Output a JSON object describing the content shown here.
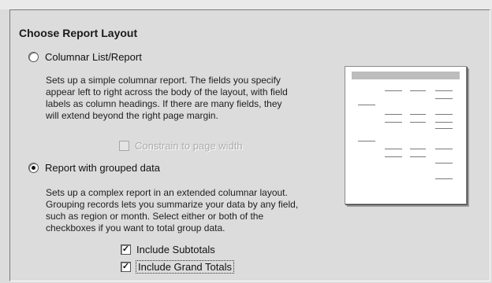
{
  "dialog": {
    "heading": "Choose Report Layout",
    "options": [
      {
        "label": "Columnar List/Report",
        "selected": false,
        "description_lines": [
          "Sets up a simple columnar report.  The fields you specify",
          "appear left to right across the body of the layout, with field",
          "labels as column headings.  If there are many fields, they",
          "will extend beyond the right page margin."
        ],
        "checkbox": {
          "label": "Constrain to page width",
          "checked": false,
          "enabled": false
        }
      },
      {
        "label": "Report with grouped data",
        "selected": true,
        "description_lines": [
          "Sets up a complex report in an extended columnar layout.",
          "Grouping records lets you summarize your data by any field,",
          "such as region or month. Select either or both of the",
          "checkboxes if you want to total group data."
        ],
        "checkboxes": [
          {
            "label": "Include Subtotals",
            "checked": true
          },
          {
            "label": "Include Grand Totals",
            "checked": true
          }
        ]
      }
    ]
  },
  "colors": {
    "dialog_bg": "#dcdcdc",
    "preview_bg": "#ffffff",
    "preview_header": "#bdbdbd",
    "preview_line": "#7a7a7a"
  },
  "icons": {
    "check": "✓"
  }
}
